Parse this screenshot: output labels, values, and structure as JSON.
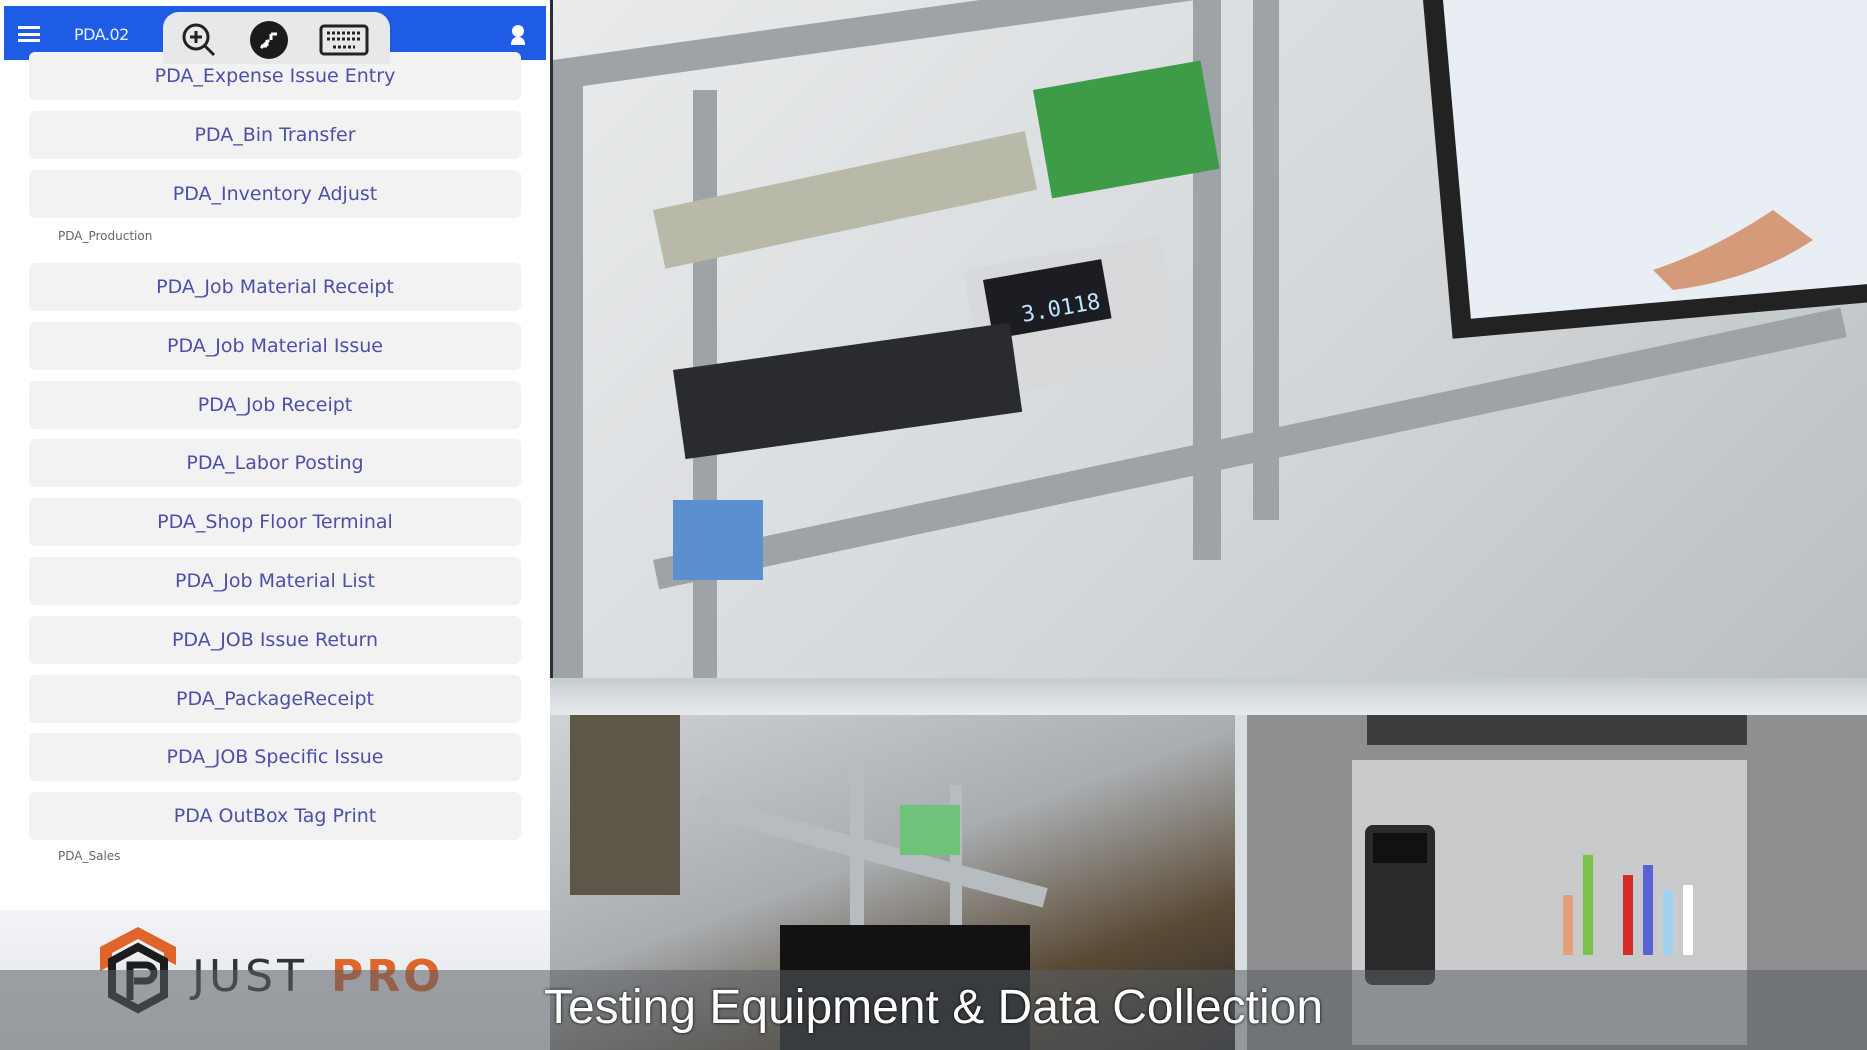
{
  "header": {
    "title": "PDA.02",
    "icons": [
      "menu-icon",
      "zoom-in-icon",
      "remote-connect-icon",
      "keyboard-icon",
      "user-icon"
    ],
    "color": "#1f5ce6"
  },
  "menu": {
    "items_top": [
      "PDA_Expense Issue Entry",
      "PDA_Bin Transfer",
      "PDA_Inventory Adjust"
    ],
    "section_production": "PDA_Production",
    "items_production": [
      "PDA_Job Material Receipt",
      "PDA_Job Material Issue",
      "PDA_Job Receipt",
      "PDA_Labor Posting",
      "PDA_Shop Floor Terminal",
      "PDA_Job Material List",
      "PDA_JOB Issue Return",
      "PDA_PackageReceipt",
      "PDA_JOB Specific Issue",
      "PDA OutBox Tag Print"
    ],
    "section_sales": "PDA_Sales"
  },
  "logo": {
    "text_a": "JUST",
    "text_b": "PRO",
    "accent": "#e0652a"
  },
  "video": {
    "meter_reading": "3.0118"
  },
  "caption": "Testing Equipment & Data Collection"
}
